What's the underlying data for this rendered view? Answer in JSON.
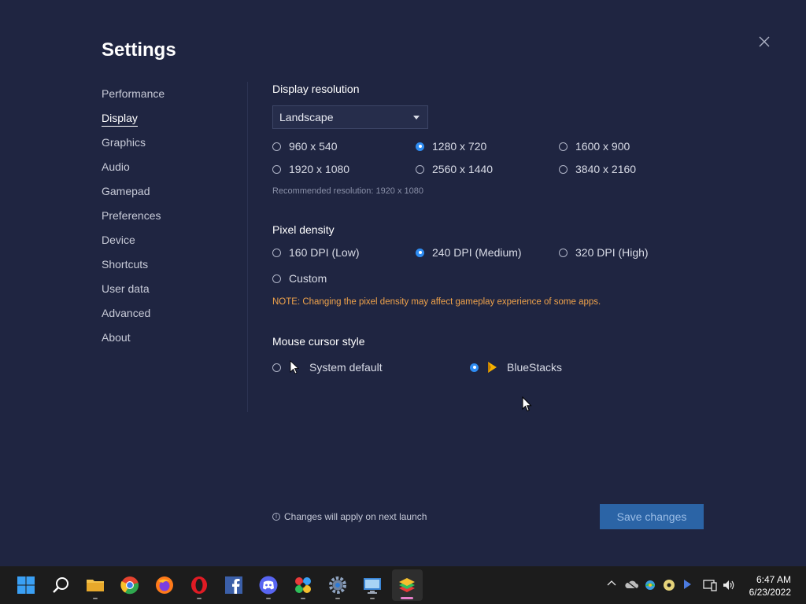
{
  "header": {
    "title": "Settings"
  },
  "sidebar": {
    "items": [
      {
        "label": "Performance"
      },
      {
        "label": "Display"
      },
      {
        "label": "Graphics"
      },
      {
        "label": "Audio"
      },
      {
        "label": "Gamepad"
      },
      {
        "label": "Preferences"
      },
      {
        "label": "Device"
      },
      {
        "label": "Shortcuts"
      },
      {
        "label": "User data"
      },
      {
        "label": "Advanced"
      },
      {
        "label": "About"
      }
    ],
    "active": "Display"
  },
  "display_resolution": {
    "heading": "Display resolution",
    "orientation": "Landscape",
    "options": [
      "960 x 540",
      "1280 x 720",
      "1600 x 900",
      "1920 x 1080",
      "2560 x 1440",
      "3840 x 2160"
    ],
    "selected": "1280 x 720",
    "recommended": "Recommended resolution: 1920 x 1080"
  },
  "pixel_density": {
    "heading": "Pixel density",
    "options": [
      "160 DPI (Low)",
      "240 DPI (Medium)",
      "320 DPI (High)",
      "Custom"
    ],
    "selected": "240 DPI (Medium)",
    "note": "NOTE: Changing the pixel density may affect gameplay experience of some apps."
  },
  "mouse_cursor": {
    "heading": "Mouse cursor style",
    "options": [
      "System default",
      "BlueStacks"
    ],
    "selected": "BlueStacks"
  },
  "footer": {
    "info": "Changes will apply on next launch",
    "save_label": "Save changes"
  },
  "taskbar": {
    "time": "6:47 AM",
    "date": "6/23/2022"
  },
  "colors": {
    "background": "#1f2541",
    "accent": "#2e8cf2",
    "note": "#f0a34b",
    "save_button": "#2b64a6"
  }
}
